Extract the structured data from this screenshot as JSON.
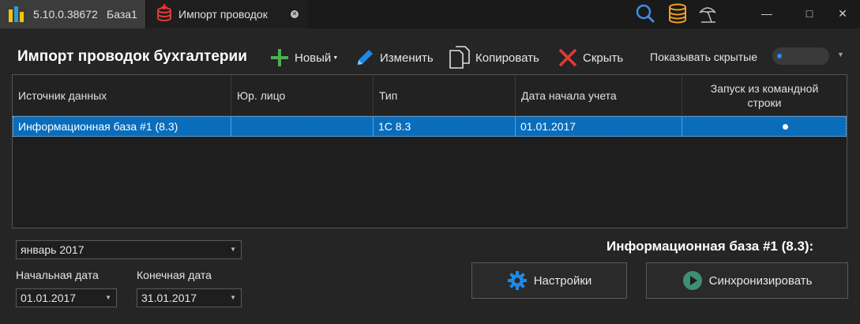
{
  "titlebar": {
    "app_version": "5.10.0.38672",
    "app_db": "База1",
    "doc_tab_label": "Импорт проводок",
    "icons": [
      "app-logo-icon",
      "database-red-icon",
      "close-circle-icon",
      "search-icon",
      "database-icon",
      "beach-umbrella-icon"
    ],
    "window_controls": {
      "minimize": "—",
      "maximize": "□",
      "close": "✕"
    }
  },
  "toolbar": {
    "title": "Импорт проводок бухгалтерии",
    "new_label": "Новый",
    "edit_label": "Изменить",
    "copy_label": "Копировать",
    "hide_label": "Скрыть",
    "show_hidden_label": "Показывать скрытые"
  },
  "grid": {
    "columns": [
      "Источник данных",
      "Юр. лицо",
      "Тип",
      "Дата начала учета",
      "Запуск из командной строки"
    ],
    "rows": [
      {
        "source": "Информационная база #1 (8.3)",
        "entity": "",
        "type": "1С 8.3",
        "start_date": "01.01.2017",
        "cmd_launch": true
      }
    ]
  },
  "period": {
    "month_value": "январь 2017",
    "start_label": "Начальная дата",
    "end_label": "Конечная дата",
    "start_value": "01.01.2017",
    "end_value": "31.01.2017"
  },
  "info": {
    "title": "Информационная база #1 (8.3):",
    "settings_label": "Настройки",
    "sync_label": "Синхронизировать"
  },
  "colors": {
    "background": "#252526",
    "selection": "#0a6dbb",
    "accent_green": "#4caf50",
    "accent_red": "#e53935",
    "accent_blue": "#1e88e5",
    "accent_orange": "#f0a020"
  }
}
